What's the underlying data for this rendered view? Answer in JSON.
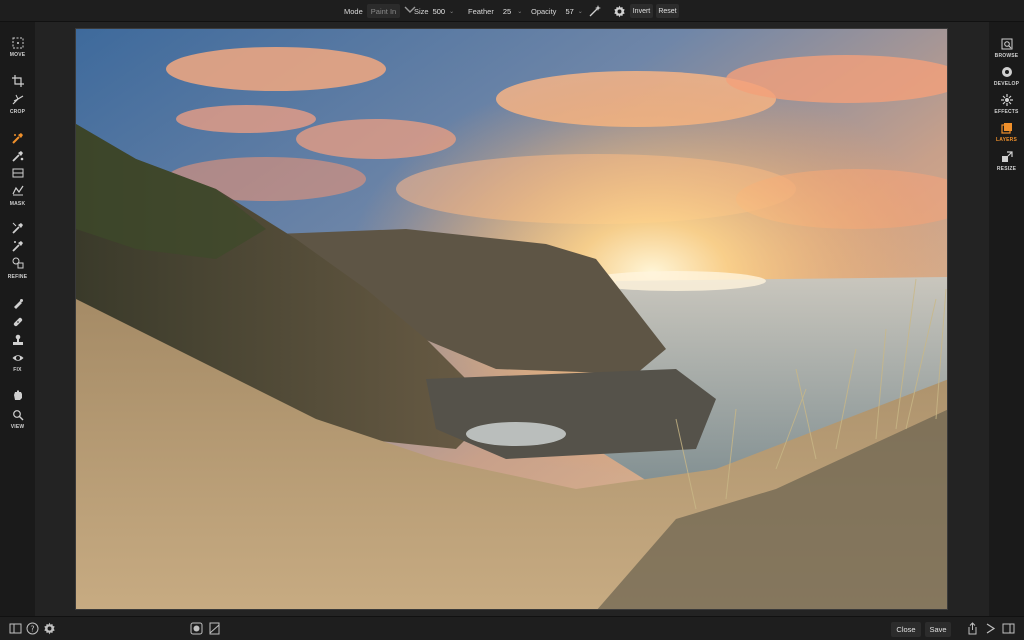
{
  "toolbar": {
    "mode_label": "Mode",
    "mode_value": "Paint In",
    "size_label": "Size",
    "size_value": "500",
    "feather_label": "Feather",
    "feather_value": "25",
    "opacity_label": "Opacity",
    "opacity_value": "57",
    "invert_label": "Invert",
    "reset_label": "Reset"
  },
  "left_tools": {
    "move": "MOVE",
    "crop": "CROP",
    "mask": "MASK",
    "refine": "REFINE",
    "fix": "FIX",
    "view": "VIEW"
  },
  "right_modules": {
    "browse": "BROWSE",
    "develop": "DEVELOP",
    "effects": "EFFECTS",
    "layers": "LAYERS",
    "resize": "RESIZE",
    "active": "LAYERS"
  },
  "bottom": {
    "close_label": "Close",
    "save_label": "Save"
  },
  "colors": {
    "accent": "#f0902b",
    "bg": "#1b1b1b",
    "panel": "#1e1e1e"
  }
}
